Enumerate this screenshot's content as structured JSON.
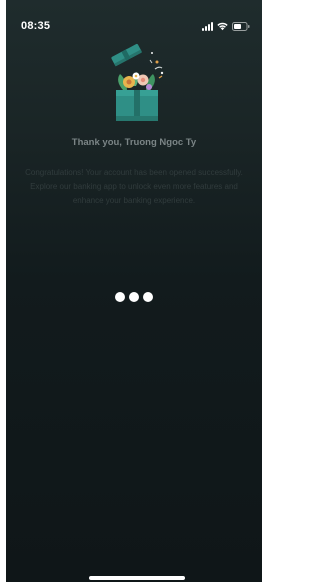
{
  "status_bar": {
    "time": "08:35",
    "icons": [
      "signal-icon",
      "wifi-icon",
      "battery-icon"
    ]
  },
  "illustration": {
    "icon": "gift-box-icon"
  },
  "title": "Thank you, Truong Ngoc Ty",
  "message": "Congratulations! Your account has been opened successfully. Explore our banking app to unlock even more features and enhance your banking experience.",
  "loading_indicator": {
    "icon": "three-dots-icon",
    "dots": 3
  },
  "colors": {
    "background": "#141d1f",
    "gift_box": "#2f8f86",
    "title_text": "#7b8586",
    "message_text": "#313c3d",
    "loader_dots": "#ffffff"
  }
}
